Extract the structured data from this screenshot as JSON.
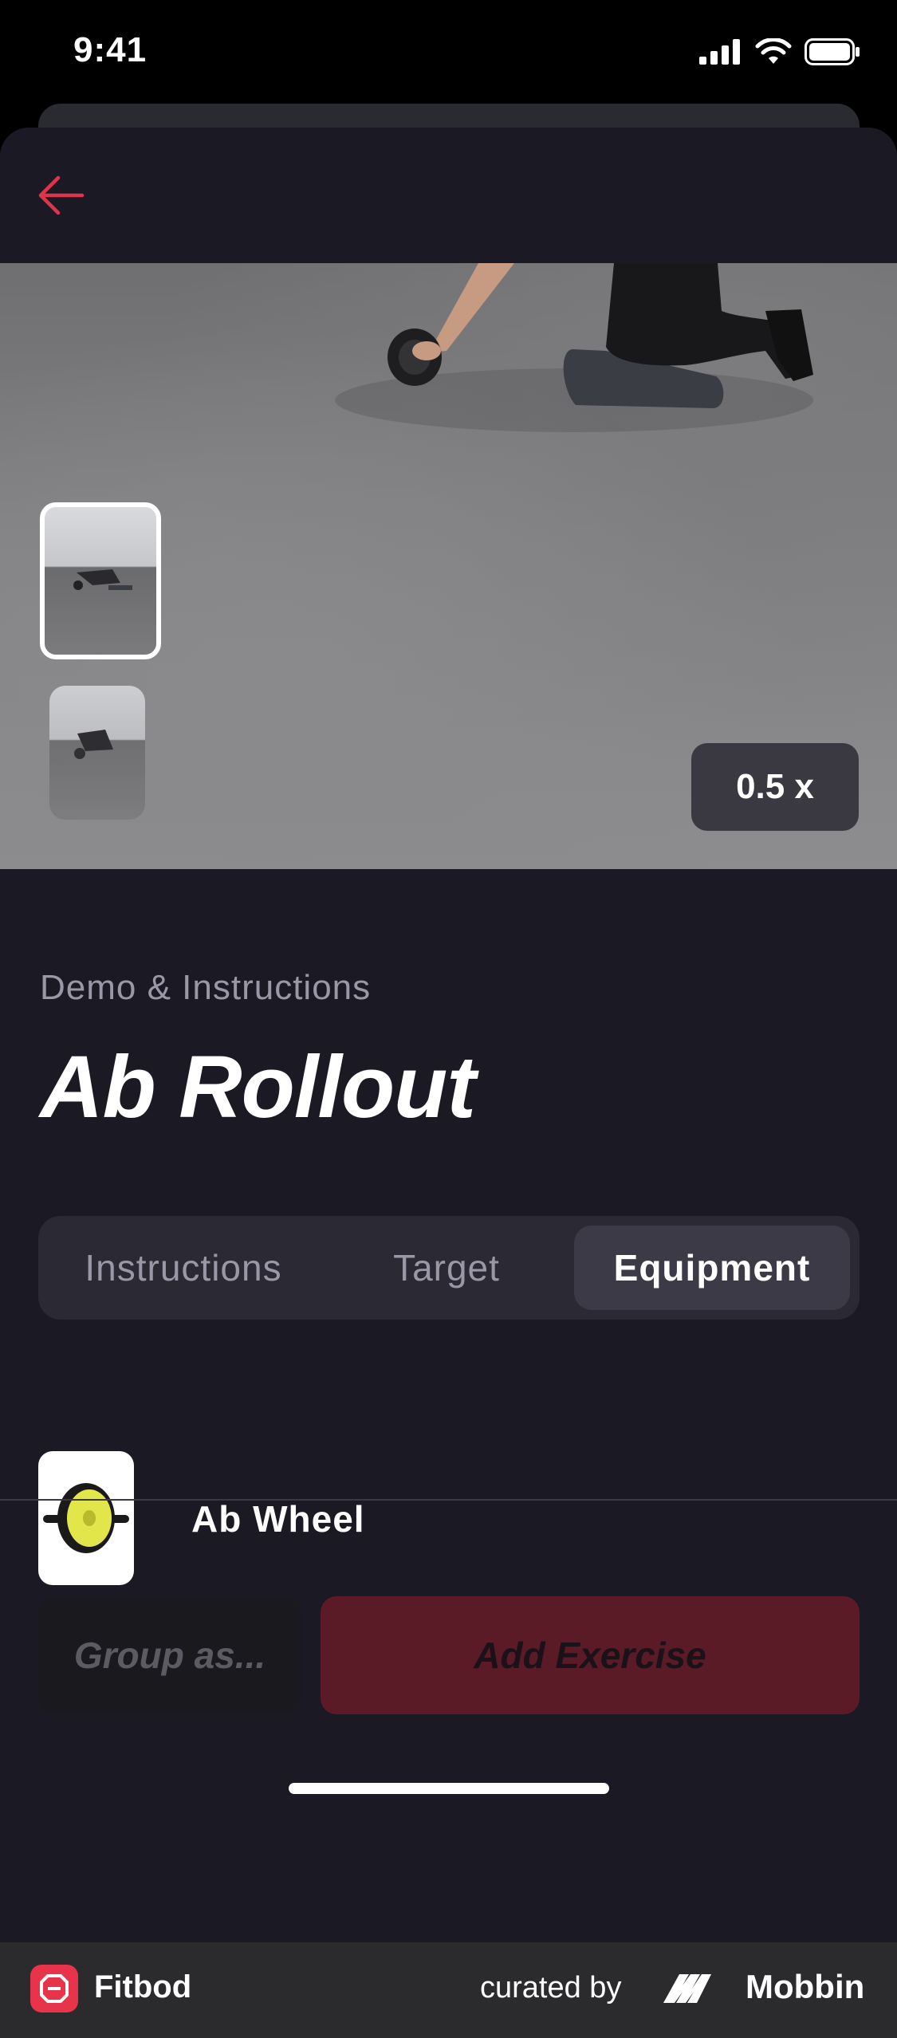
{
  "status_bar": {
    "time": "9:41"
  },
  "header": {
    "back_icon": "arrow-left-icon"
  },
  "video": {
    "speed": "0.5 x",
    "thumbnails": [
      "exercise-demo-view-1",
      "exercise-demo-view-2"
    ]
  },
  "exercise": {
    "section_label": "Demo & Instructions",
    "title": "Ab Rollout"
  },
  "tabs": [
    {
      "label": "Instructions",
      "active": false
    },
    {
      "label": "Target",
      "active": false
    },
    {
      "label": "Equipment",
      "active": true
    }
  ],
  "equipment": [
    {
      "name": "Ab Wheel",
      "icon": "ab-wheel-icon"
    }
  ],
  "actions": {
    "group_label": "Group as...",
    "add_label": "Add Exercise"
  },
  "footer": {
    "app_name": "Fitbod",
    "curated_by": "curated by",
    "brand": "Mobbin"
  },
  "colors": {
    "accent": "#e0344d",
    "background": "#1b1a24",
    "add_button": "#5a1b27"
  }
}
